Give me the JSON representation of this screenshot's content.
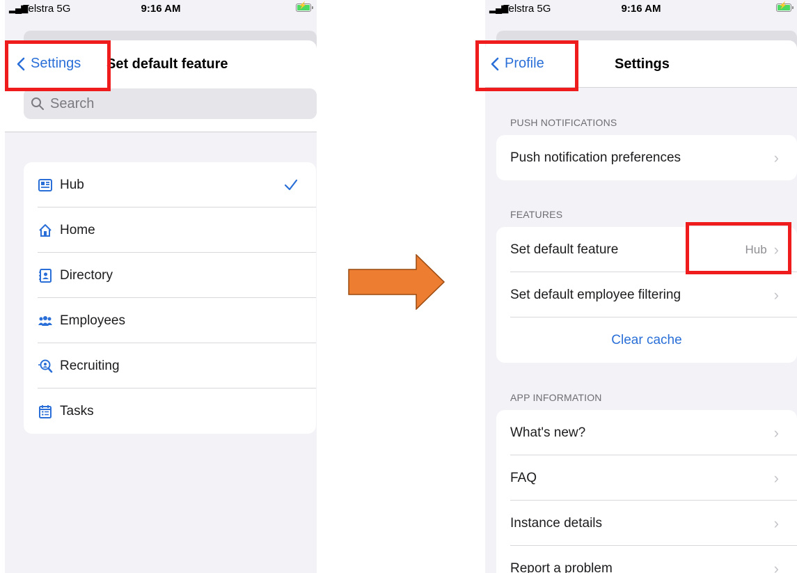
{
  "status": {
    "carrier": "Telstra 5G",
    "time": "9:16 AM"
  },
  "left_screen": {
    "back_label": "Settings",
    "title": "Set default feature",
    "search_placeholder": "Search",
    "items": [
      {
        "label": "Hub",
        "icon": "hub-icon",
        "selected": true
      },
      {
        "label": "Home",
        "icon": "home-icon"
      },
      {
        "label": "Directory",
        "icon": "directory-icon"
      },
      {
        "label": "Employees",
        "icon": "employees-icon"
      },
      {
        "label": "Recruiting",
        "icon": "recruiting-icon"
      },
      {
        "label": "Tasks",
        "icon": "tasks-icon"
      }
    ]
  },
  "right_screen": {
    "back_label": "Profile",
    "title": "Settings",
    "sections": {
      "push": {
        "header": "PUSH NOTIFICATIONS",
        "items": [
          "Push notification preferences"
        ]
      },
      "features": {
        "header": "FEATURES",
        "default_feature": {
          "label": "Set default feature",
          "value": "Hub"
        },
        "employee_filtering": "Set default employee filtering",
        "clear_cache": "Clear cache"
      },
      "app_info": {
        "header": "APP INFORMATION",
        "items": [
          "What's new?",
          "FAQ",
          "Instance details",
          "Report a problem"
        ]
      }
    }
  },
  "colors": {
    "accent": "#2a6fd8",
    "highlight": "#ee1c1c",
    "arrow": "#ed7d31"
  }
}
